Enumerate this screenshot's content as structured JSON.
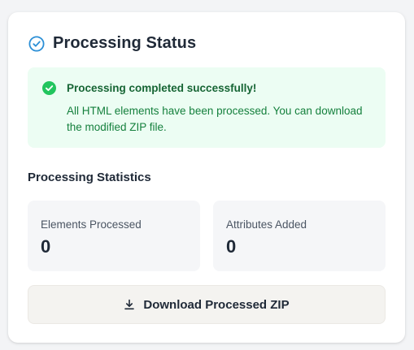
{
  "colors": {
    "accent": "#2b8fd6",
    "success": "#22c55e",
    "success_bg": "#ecfdf3",
    "success_text": "#166534"
  },
  "header": {
    "icon": "check-circle-icon",
    "title": "Processing Status"
  },
  "alert": {
    "icon": "success-check-icon",
    "title": "Processing completed successfully!",
    "message": "All HTML elements have been processed. You can download the modified ZIP file."
  },
  "statistics": {
    "title": "Processing Statistics",
    "elements_processed": {
      "label": "Elements Processed",
      "value": "0"
    },
    "attributes_added": {
      "label": "Attributes Added",
      "value": "0"
    }
  },
  "download": {
    "icon": "download-icon",
    "label": "Download Processed ZIP"
  }
}
